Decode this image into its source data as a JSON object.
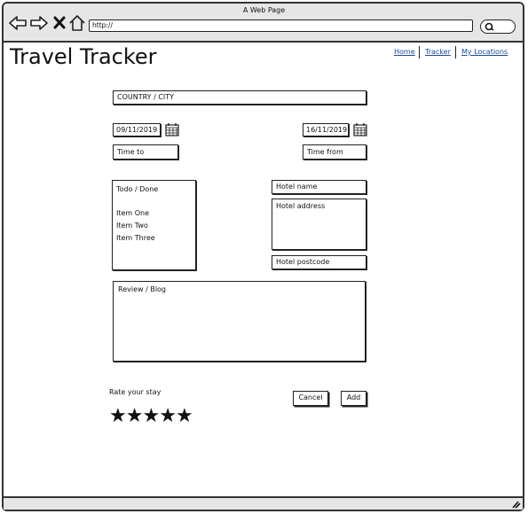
{
  "window": {
    "title": "A Web Page"
  },
  "browser": {
    "url": "http://"
  },
  "header": {
    "brand": "Travel Tracker"
  },
  "nav": {
    "home": "Home",
    "tracker": "Tracker",
    "my_locations": "My Locations"
  },
  "form": {
    "country_city_placeholder": "COUNTRY / CITY",
    "date_start": "09/11/2019",
    "date_end": "16/11/2019",
    "time_to": "Time to",
    "time_from": "Time from",
    "todo": {
      "title": "Todo / Done",
      "items": [
        "Item One",
        "Item Two",
        "Item Three"
      ]
    },
    "hotel_name": "Hotel name",
    "hotel_address": "Hotel address",
    "hotel_postcode": "Hotel postcode",
    "review": "Review / Blog",
    "rate_label": "Rate your stay",
    "rating": 5,
    "cancel_label": "Cancel",
    "add_label": "Add"
  },
  "icons": [
    "back-icon",
    "forward-icon",
    "close-icon",
    "home-icon",
    "search-icon",
    "calendar-icon",
    "star-icon",
    "resize-grip-icon"
  ]
}
